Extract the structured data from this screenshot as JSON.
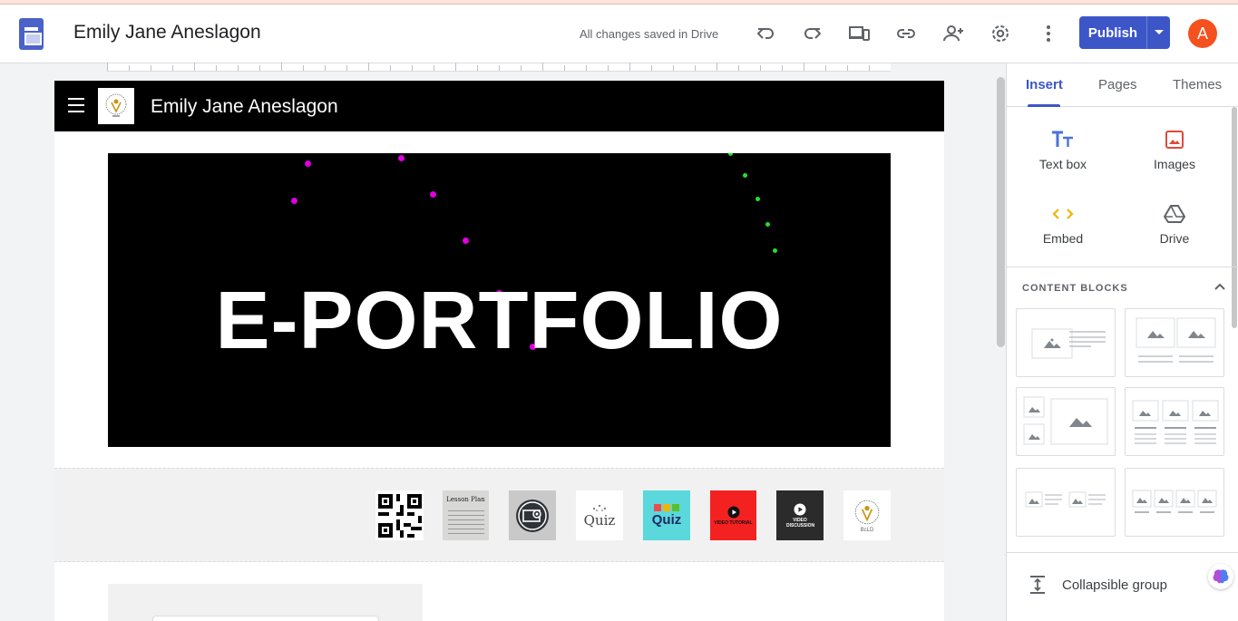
{
  "header": {
    "doc_title": "Emily Jane Aneslagon",
    "save_status": "All changes saved in Drive",
    "publish_label": "Publish",
    "avatar_initial": "A",
    "icons": [
      "undo-icon",
      "redo-icon",
      "preview-devices-icon",
      "link-icon",
      "share-icon",
      "settings-icon",
      "more-vert-icon"
    ]
  },
  "site": {
    "title": "Emily Jane Aneslagon",
    "hero_text": "E-PORTFOLIO",
    "thumbnails": [
      {
        "name": "qr-code",
        "label": ""
      },
      {
        "name": "lesson-plan",
        "label": "Lesson Plan"
      },
      {
        "name": "screen-recorder",
        "label": ""
      },
      {
        "name": "quiz-white",
        "label": "Quiz"
      },
      {
        "name": "quiz-color",
        "label": "Quiz"
      },
      {
        "name": "video-tutorial",
        "label": "VIDEO TUTORIAL"
      },
      {
        "name": "video-discussion",
        "label": "VIDEO DISCUSSION"
      },
      {
        "name": "logo",
        "label": "BcLD"
      }
    ]
  },
  "panel": {
    "tabs": [
      "Insert",
      "Pages",
      "Themes"
    ],
    "active_tab": "Insert",
    "insert_items": [
      {
        "label": "Text box",
        "icon": "text-box-icon"
      },
      {
        "label": "Images",
        "icon": "image-icon"
      },
      {
        "label": "Embed",
        "icon": "embed-icon"
      },
      {
        "label": "Drive",
        "icon": "drive-icon"
      }
    ],
    "content_blocks_heading": "CONTENT BLOCKS",
    "collapsible_label": "Collapsible group"
  },
  "colors": {
    "accent": "#3c56c8",
    "avatar": "#f4511e",
    "hero_bg": "#000000",
    "dot_magenta": "#e100e1",
    "dot_green": "#22e22a"
  }
}
